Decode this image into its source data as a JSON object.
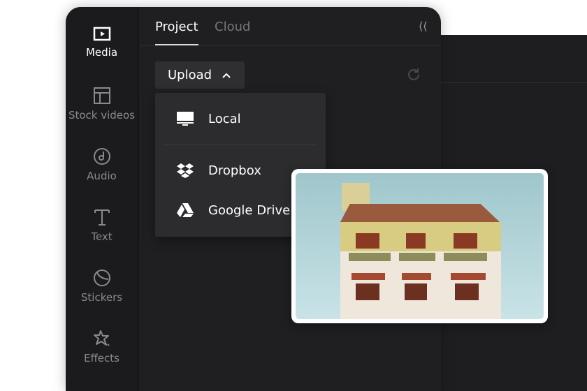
{
  "sidebar": {
    "items": [
      {
        "label": "Media",
        "icon": "play-square-icon",
        "active": true
      },
      {
        "label": "Stock videos",
        "icon": "layout-icon"
      },
      {
        "label": "Audio",
        "icon": "music-note-icon"
      },
      {
        "label": "Text",
        "icon": "text-icon"
      },
      {
        "label": "Stickers",
        "icon": "sticker-icon"
      },
      {
        "label": "Effects",
        "icon": "sparkle-star-icon"
      }
    ]
  },
  "tabs": [
    {
      "label": "Project",
      "active": true
    },
    {
      "label": "Cloud"
    }
  ],
  "upload": {
    "label": "Upload",
    "menu": [
      {
        "label": "Local",
        "icon": "monitor-icon"
      },
      {
        "label": "Dropbox",
        "icon": "dropbox-icon"
      },
      {
        "label": "Google Drive",
        "icon": "google-drive-icon"
      }
    ]
  }
}
